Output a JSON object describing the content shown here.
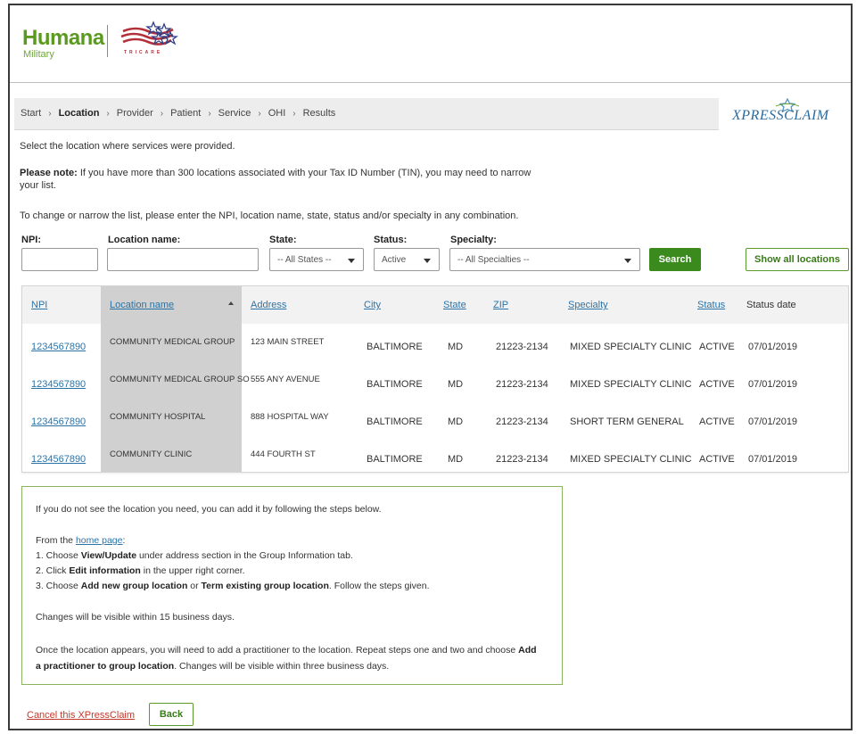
{
  "header": {
    "logo_brand": "Humana",
    "logo_sub": "Military",
    "tricare_word": "TRICARE"
  },
  "breadcrumb": [
    {
      "label": "Start",
      "active": false
    },
    {
      "label": "Location",
      "active": true
    },
    {
      "label": "Provider",
      "active": false
    },
    {
      "label": "Patient",
      "active": false
    },
    {
      "label": "Service",
      "active": false
    },
    {
      "label": "OHI",
      "active": false
    },
    {
      "label": "Results",
      "active": false
    }
  ],
  "xpress_logo": "XPRESSCLAIM",
  "intro": {
    "select_text": "Select the location where services were provided.",
    "note_bold": "Please note:",
    "note_line1": " If you have more than 300 locations associated with your Tax ID Number (TIN), you may need to narrow",
    "note_line2": "your list.",
    "narrow_text": "To change or narrow the list, please enter the NPI, location name, state, status and/or specialty in any combination."
  },
  "filters": {
    "npi_label": "NPI:",
    "location_label": "Location name:",
    "state_label": "State:",
    "state_value": "-- All States --",
    "status_label": "Status:",
    "status_value": "Active",
    "specialty_label": "Specialty:",
    "specialty_value": "-- All Specialties --",
    "search_button": "Search",
    "show_all_button": "Show all locations"
  },
  "table": {
    "headers": {
      "npi": "NPI",
      "location_name": "Location name",
      "address": "Address",
      "city": "City",
      "state": "State",
      "zip": "ZIP",
      "specialty": "Specialty",
      "status": "Status",
      "status_date": "Status date"
    },
    "rows": [
      {
        "npi": "1234567890",
        "location": "COMMUNITY MEDICAL GROUP",
        "address": "123 MAIN STREET",
        "city": "BALTIMORE",
        "state": "MD",
        "zip": "21223-2134",
        "specialty": "MIXED SPECIALTY CLINIC",
        "status": "ACTIVE",
        "date": "07/01/2019"
      },
      {
        "npi": "1234567890",
        "location": "COMMUNITY MEDICAL GROUP SO",
        "address": "555 ANY AVENUE",
        "city": "BALTIMORE",
        "state": "MD",
        "zip": "21223-2134",
        "specialty": "MIXED SPECIALTY CLINIC",
        "status": "ACTIVE",
        "date": "07/01/2019"
      },
      {
        "npi": "1234567890",
        "location": "COMMUNITY HOSPITAL",
        "address": "888 HOSPITAL WAY",
        "city": "BALTIMORE",
        "state": "MD",
        "zip": "21223-2134",
        "specialty": "SHORT TERM GENERAL",
        "status": "ACTIVE",
        "date": "07/01/2019"
      },
      {
        "npi": "1234567890",
        "location": "COMMUNITY CLINIC",
        "address": "444 FOURTH ST",
        "city": "BALTIMORE",
        "state": "MD",
        "zip": "21223-2134",
        "specialty": "MIXED SPECIALTY CLINIC",
        "status": "ACTIVE",
        "date": "07/01/2019"
      }
    ]
  },
  "info": {
    "line1": "If you do not see the location you need, you can add it by following the steps below.",
    "from_prefix": "From the ",
    "home_link": "home page",
    "from_suffix": ":",
    "step1_num": "1. Choose ",
    "step1_bold": "View/Update",
    "step1_rest": " under address section in the Group Information tab.",
    "step2_num": "2. Click ",
    "step2_bold": "Edit information",
    "step2_rest": " in the upper right corner.",
    "step3_num": "3. Choose ",
    "step3_bold1": "Add new group location",
    "step3_mid": " or ",
    "step3_bold2": "Term existing group location",
    "step3_rest": ". Follow the steps given.",
    "changes1": "Changes will be visible within 15 business days.",
    "once_a": "Once the location appears, you will need to add a practitioner to the location. Repeat steps one and two and choose ",
    "once_bold1": "Add",
    "once_bold2": "a practitioner to group location",
    "once_b": ". Changes will be visible within three business days."
  },
  "footer": {
    "cancel_link": "Cancel this XPressClaim",
    "back_button": "Back"
  },
  "colors": {
    "accent_green": "#3a8a1e",
    "link_blue": "#2b73a6",
    "cancel_red": "#c0392b"
  }
}
